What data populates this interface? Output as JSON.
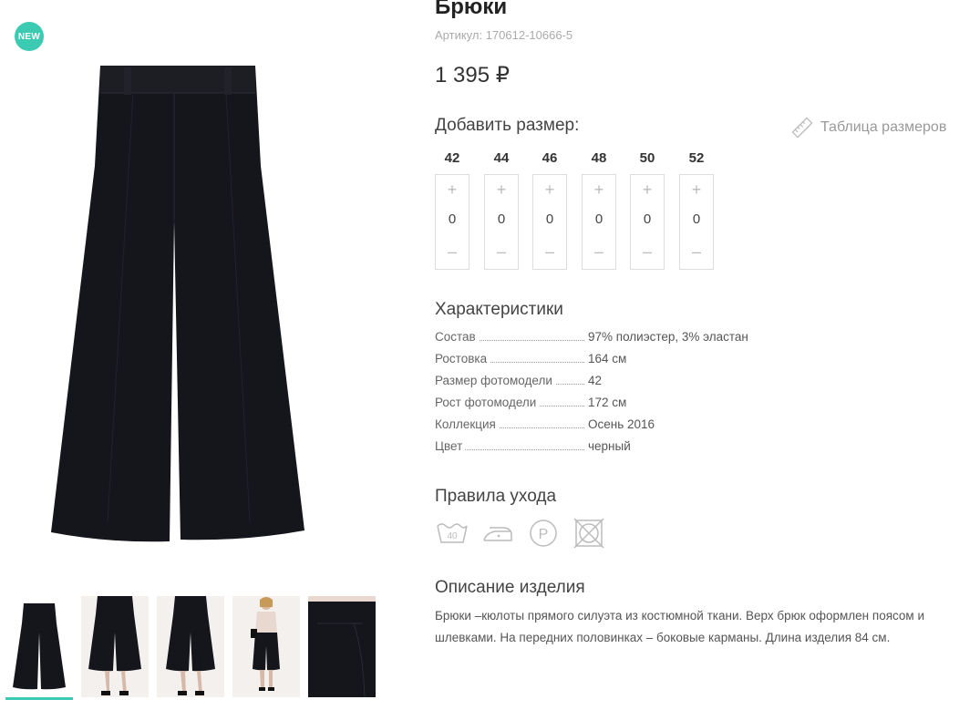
{
  "badge": "NEW",
  "product": {
    "title": "Брюки",
    "sku": "Артикул: 170612-10666-5",
    "price": "1 395 ₽"
  },
  "sizes_section": {
    "label": "Добавить размер:",
    "size_table_link": "Таблица размеров",
    "sizes": [
      {
        "size": "42",
        "qty": "0"
      },
      {
        "size": "44",
        "qty": "0"
      },
      {
        "size": "46",
        "qty": "0"
      },
      {
        "size": "48",
        "qty": "0"
      },
      {
        "size": "50",
        "qty": "0"
      },
      {
        "size": "52",
        "qty": "0"
      }
    ],
    "plus": "+",
    "minus": "–"
  },
  "characteristics": {
    "title": "Характеристики",
    "rows": [
      {
        "key": "Состав",
        "value": "97% полиэстер, 3% эластан"
      },
      {
        "key": "Ростовка",
        "value": "164 см"
      },
      {
        "key": "Размер фотомодели",
        "value": "42"
      },
      {
        "key": "Рост фотомодели",
        "value": "172 см"
      },
      {
        "key": "Коллекция",
        "value": "Осень 2016"
      },
      {
        "key": "Цвет",
        "value": "черный"
      }
    ]
  },
  "care": {
    "title": "Правила ухода",
    "wash_temp": "40",
    "press_letter": "P",
    "icons": [
      "wash-40-icon",
      "iron-icon",
      "dry-clean-p-icon",
      "no-tumble-dry-icon"
    ]
  },
  "description": {
    "title": "Описание изделия",
    "text": "Брюки –кюлоты прямого силуэта из костюмной ткани. Верх брюк оформлен поясом и шлевками. На передних половинках – боковые карманы. Длина изделия 84 см."
  },
  "colors": {
    "accent": "#3ccab2",
    "product": "#15151c"
  }
}
